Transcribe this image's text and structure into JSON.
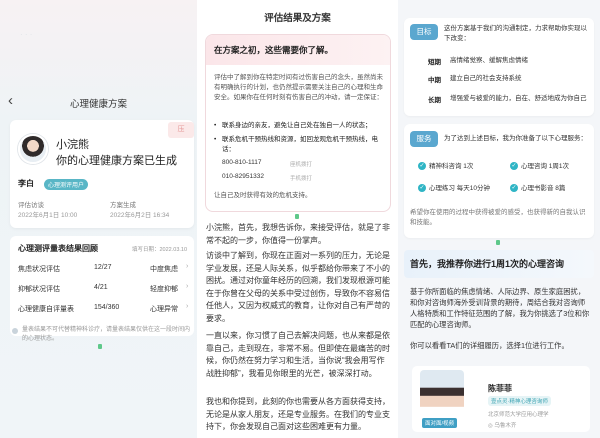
{
  "panel1": {
    "back": "‹",
    "title": "心理健康方案",
    "user_name": "小浣熊",
    "plan_headline": "你的心理健康方案已生成",
    "corner_tag": "压",
    "user_label": "李白",
    "user_badge": "心理测评用户",
    "eval_time_label": "评估访谈",
    "eval_time": "2022年6月1日 10:00",
    "plan_time_label": "方案生成",
    "plan_time": "2022年6月2日 16:34",
    "scale_title": "心理测评量表结果回顾",
    "scale_date": "填写日期：2022.03.10",
    "scales": [
      {
        "name": "焦虑状况评估",
        "score": "12/27",
        "level": "中度焦虑",
        "arrow": "›"
      },
      {
        "name": "抑郁状况评估",
        "score": "4/21",
        "level": "轻度抑郁",
        "arrow": "›"
      },
      {
        "name": "心理健康自评量表",
        "score": "154/360",
        "level": "心理异常",
        "arrow": "›"
      }
    ],
    "disclaimer": "量表结果不可代替精神科诊疗，请量表结果仅供在这一段时间内的心理状态。"
  },
  "panel2": {
    "header": "评估结果及方案",
    "box_title": "在方案之初，这些需要你了解。",
    "box_body": "评估中了解到你在特定时间有过伤害自己的念头，虽然尚未有明确执行的计划，也仍然提示需要关注自己的心理和生命安全。如果你在任何时刻有伤害自己的冲动，请一定保证：",
    "bullet1": "联系身边的亲友，避免让自己处在独自一人的状态；",
    "bullet2": "联系危机干预热线和资源，如回龙观危机干预热线，电话：",
    "phone1": "800-810-1117",
    "phone1_note": "座机拨打",
    "phone2": "010-82951332",
    "phone2_note": "手机拨打",
    "box_footer": "让自己及时获得有效的危机支持。",
    "paragraph1": "小浣熊，首先，我想告诉你，来接受评估，就是了非常不起的一步，你值得一份掌声。",
    "paragraph2": "访谈中了解到，你现在正面对一系列的压力，无论是学业发展，还是人际关系，似乎都给你带来了不小的困扰。通过对你童年经历的回溯，我们发现根源可能在于你曾在父母的关系中受过创伤，导致你不容易信任他人，又因为权威式的教育，让你对自己有严苛的要求。",
    "paragraph3": "一直以来，你习惯了自己去解决问题，也从来都是依靠自己，走到现在，非常不易。但即使在最痛苦的时候，你仍然在努力学习和生活，当你说“我会用写作战胜抑郁”，我看见你眼里的光芒，被深深打动。",
    "paragraph4": "我也和你提到，此刻的你也需要从各方面获得支持，无论是从家人朋友，还是专业服务。在我们的专业支持下，你会发现自己面对这些困难更有力量。"
  },
  "panel3": {
    "goal_chip": "目标",
    "goal_text": "这份方案基于我们的沟通制定，力求帮助你实现以下改变：",
    "goals": [
      {
        "term": "短期",
        "text": "高情绪觉察、缓解焦虑情绪"
      },
      {
        "term": "中期",
        "text": "建立自己的社会支持系统"
      },
      {
        "term": "长期",
        "text": "增强爱与被爱的能力，自在、舒适地成为你自己"
      }
    ],
    "service_chip": "服务",
    "service_text": "为了达到上述目标，我为你准备了以下心理服务：",
    "services": [
      {
        "text": "精神科咨询 1次"
      },
      {
        "text": "心理咨询 1周1次"
      },
      {
        "text": "心理练习 每天10分钟"
      },
      {
        "text": "心理书影音 8篇"
      }
    ],
    "service_note": "希望你在使用的过程中获得被爱的感受，也获得新的自我认识和技能。",
    "recommend_title": "首先，我推荐你进行1周1次的心理咨询",
    "recommend_p1": "基于你所面临的焦虑情绪、人际边界、原生家庭困扰，和你对咨询师海外受训背景的期待，周结合我对咨询师人格特质和工作特征范围的了解，我为你挑选了3位和你匹配的心理咨询师。",
    "recommend_p2": "你可以看看TA们的详细履历，选择1位进行工作。",
    "doctor_name": "陈菲菲",
    "doctor_tag": "壹点灵·精神心理咨询师",
    "doctor_org": "北京师范大学应用心理学",
    "doctor_loc": "◎ 乌鲁木齐",
    "doctor_badge": "面对面/视频"
  },
  "colors": {
    "accent": "#5aa7cf",
    "teal": "#2fb5c5",
    "pink": "#fbe6e9"
  }
}
